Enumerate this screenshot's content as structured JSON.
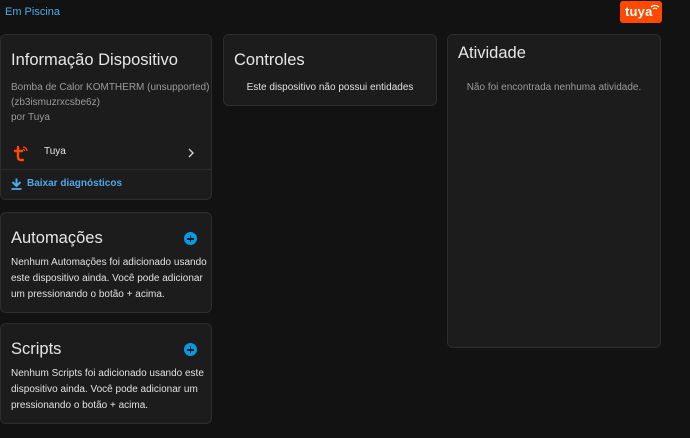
{
  "topbar": {
    "breadcrumb": "Em Piscina",
    "brand_logo_text": "tuya"
  },
  "device_info": {
    "title": "Informação Dispositivo",
    "model_line": "Bomba de Calor KOMTHERM (unsupported)",
    "id_line": "(zb3ismuzrxcsbe6z)",
    "by_line": "por Tuya",
    "integration_label": "Tuya",
    "download_label": "Baixar diagnósticos"
  },
  "automations": {
    "title": "Automações",
    "empty_text": "Nenhum Automações foi adicionado usando este dispositivo ainda. Você pode adicionar um pressionando o botão + acima."
  },
  "scripts": {
    "title": "Scripts",
    "empty_text": "Nenhum Scripts foi adicionado usando este dispositivo ainda. Você pode adicionar um pressionando o botão + acima."
  },
  "controls": {
    "title": "Controles",
    "empty_text": "Este dispositivo não possui entidades"
  },
  "activity": {
    "title": "Atividade",
    "empty_text": "Não foi encontrada nenhuma atividade."
  },
  "colors": {
    "background": "#121212",
    "card": "#1c1c1c",
    "link": "#4fa9e8",
    "accent": "#039be5",
    "tuya_orange": "#ff4800"
  },
  "icons": {
    "integration": "tuya-icon",
    "integration_chevron": "chevron-right-icon",
    "download": "download-icon",
    "add": "plus-circle-icon"
  }
}
